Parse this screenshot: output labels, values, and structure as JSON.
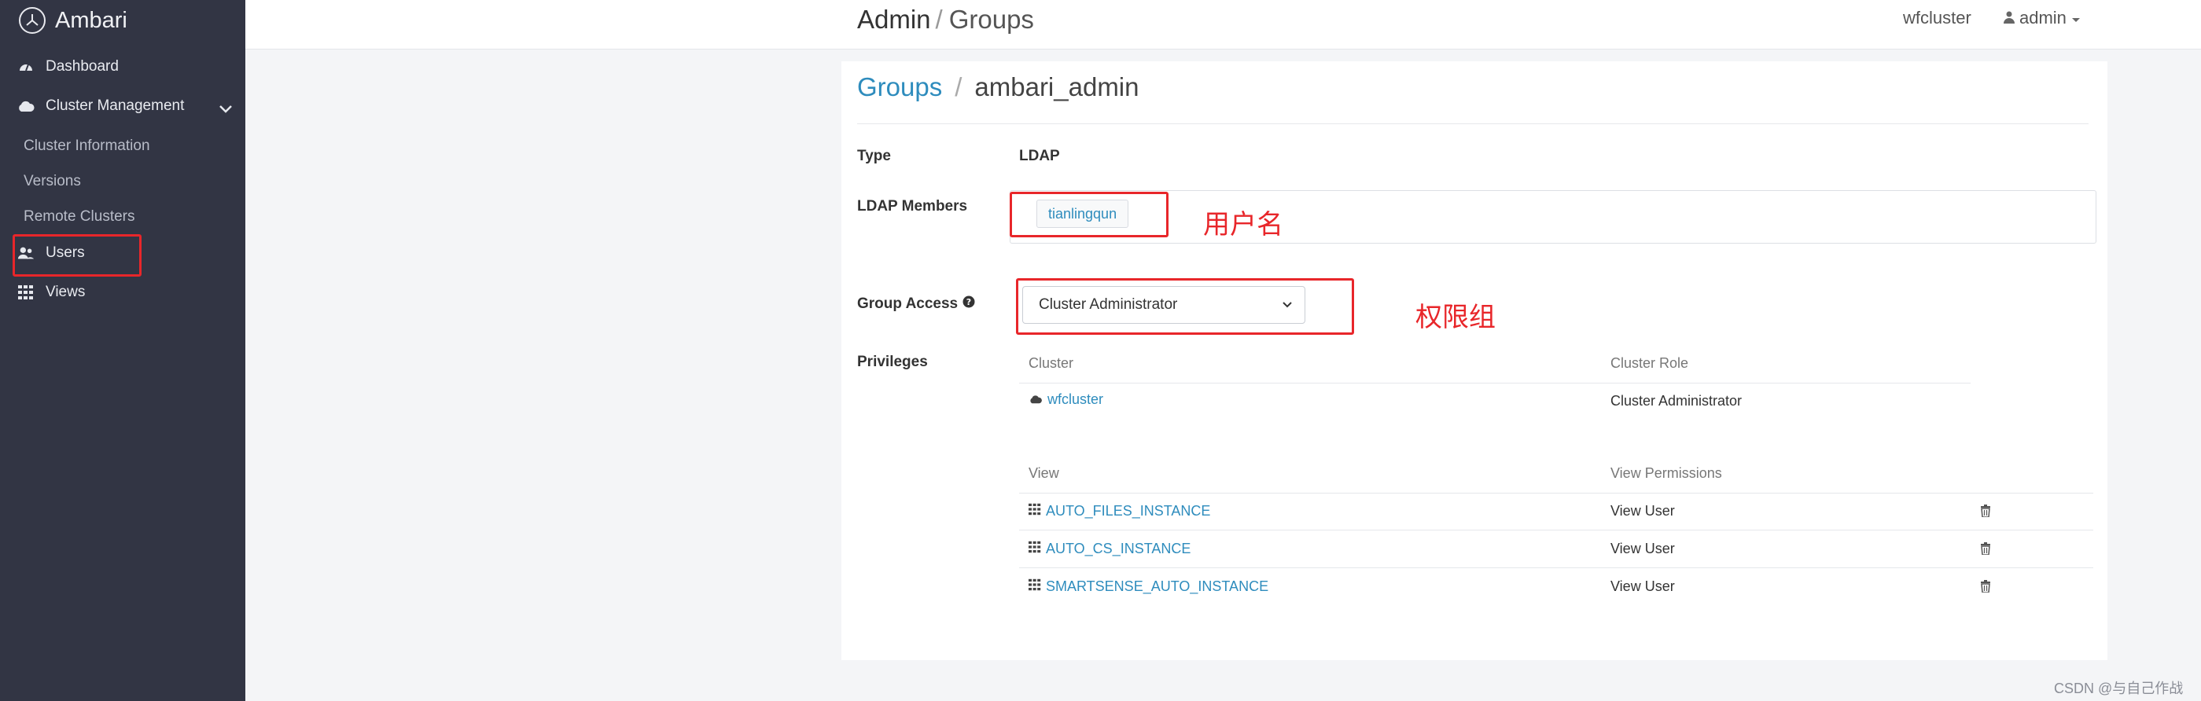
{
  "app": {
    "name": "Ambari"
  },
  "sidebar": {
    "items": [
      {
        "label": "Dashboard",
        "icon": "dashboard-icon"
      },
      {
        "label": "Cluster Management",
        "icon": "cloud-icon"
      },
      {
        "label": "Cluster Information"
      },
      {
        "label": "Versions"
      },
      {
        "label": "Remote Clusters"
      },
      {
        "label": "Users",
        "icon": "users-icon"
      },
      {
        "label": "Views",
        "icon": "grid-icon"
      }
    ]
  },
  "header": {
    "title": "Admin",
    "section": "Groups",
    "cluster": "wfcluster",
    "user": "admin"
  },
  "breadcrumb": {
    "parent": "Groups",
    "current": "ambari_admin"
  },
  "group": {
    "type_label": "Type",
    "type_value": "LDAP",
    "members_label": "LDAP Members",
    "members": [
      "tianlingqun"
    ],
    "access_label": "Group Access",
    "access_value": "Cluster Administrator",
    "privileges_label": "Privileges"
  },
  "cluster_table": {
    "headers": [
      "Cluster",
      "Cluster Role"
    ],
    "rows": [
      {
        "name": "wfcluster",
        "role": "Cluster Administrator"
      }
    ]
  },
  "view_table": {
    "headers": [
      "View",
      "View Permissions"
    ],
    "rows": [
      {
        "name": "AUTO_FILES_INSTANCE",
        "permission": "View User"
      },
      {
        "name": "AUTO_CS_INSTANCE",
        "permission": "View User"
      },
      {
        "name": "SMARTSENSE_AUTO_INSTANCE",
        "permission": "View User"
      }
    ]
  },
  "annotations": {
    "username": "用户名",
    "permission_group": "权限组"
  },
  "watermark": "CSDN @与自己作战",
  "colors": {
    "sidebar": "#323544",
    "link": "#2e8cbd",
    "annotation": "#e8262a"
  }
}
